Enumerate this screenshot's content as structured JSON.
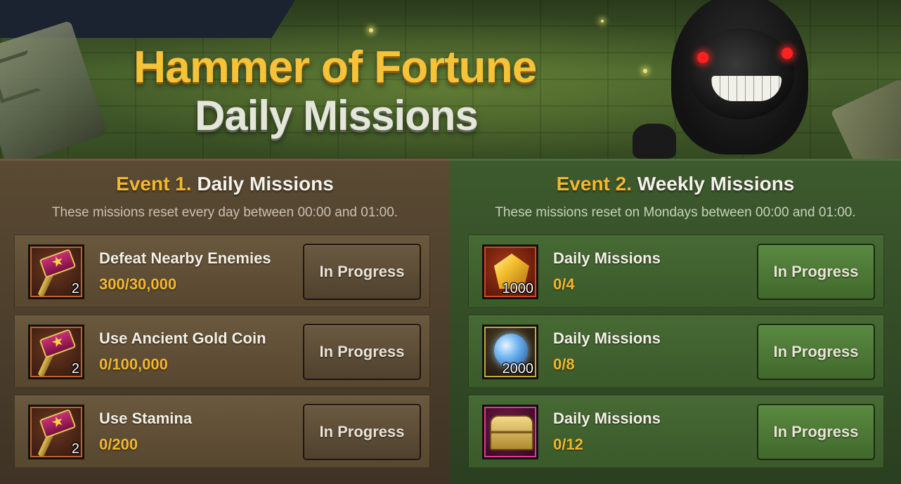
{
  "banner": {
    "title_line1": "Hammer of Fortune",
    "title_line2": "Daily Missions"
  },
  "event1": {
    "number_label": "Event 1.",
    "title": "Daily Missions",
    "description": "These missions reset every day between 00:00 and 01:00.",
    "missions": [
      {
        "name": "Defeat Nearby Enemies",
        "progress": "300/30,000",
        "reward_icon": "hammer-icon",
        "reward_count": "2",
        "status": "In Progress"
      },
      {
        "name": "Use Ancient Gold Coin",
        "progress": "0/100,000",
        "reward_icon": "hammer-icon",
        "reward_count": "2",
        "status": "In Progress"
      },
      {
        "name": "Use Stamina",
        "progress": "0/200",
        "reward_icon": "hammer-icon",
        "reward_count": "2",
        "status": "In Progress"
      }
    ]
  },
  "event2": {
    "number_label": "Event 2.",
    "title": "Weekly Missions",
    "description": "These missions reset on Mondays between 00:00 and 01:00.",
    "missions": [
      {
        "name": "Daily Missions",
        "progress": "0/4",
        "reward_icon": "gold-gem-icon",
        "reward_count": "1000",
        "status": "In Progress"
      },
      {
        "name": "Daily Missions",
        "progress": "0/8",
        "reward_icon": "blue-orb-icon",
        "reward_count": "2000",
        "status": "In Progress"
      },
      {
        "name": "Daily Missions",
        "progress": "0/12",
        "reward_icon": "treasure-chest-icon",
        "reward_count": "",
        "status": "In Progress"
      }
    ]
  },
  "colors": {
    "accent_gold": "#f3b72d",
    "event1_panel": "#5a4a33",
    "event2_panel": "#3d5a2e"
  }
}
